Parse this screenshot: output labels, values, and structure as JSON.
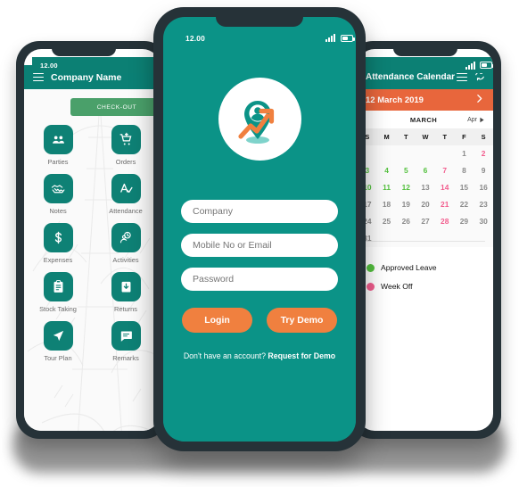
{
  "left_phone": {
    "status_time": "12.00",
    "appbar": {
      "menu_icon": "hamburger-icon",
      "title": "Company Name"
    },
    "checkout_label": "CHECK-OUT",
    "menu_items": [
      {
        "label": "Parties",
        "icon": "people-group-icon"
      },
      {
        "label": "Orders",
        "icon": "shopping-cart-plus-icon"
      },
      {
        "label": "Notes",
        "icon": "handshake-icon"
      },
      {
        "label": "Attendance",
        "icon": "attendance-check-icon"
      },
      {
        "label": "Expenses",
        "icon": "dollar-icon"
      },
      {
        "label": "Activities",
        "icon": "activity-chat-icon"
      },
      {
        "label": "Stock Taking",
        "icon": "clipboard-icon"
      },
      {
        "label": "Returns",
        "icon": "return-box-icon"
      },
      {
        "label": "Tour Plan",
        "icon": "navigation-arrow-icon"
      },
      {
        "label": "Remarks",
        "icon": "message-icon"
      }
    ]
  },
  "center_phone": {
    "status_time": "12.00",
    "logo_icon": "location-pin-growth-logo",
    "fields": [
      {
        "placeholder": "Company",
        "value": "",
        "name": "company-field"
      },
      {
        "placeholder": "Mobile No or Email",
        "value": "",
        "name": "mobile-email-field"
      },
      {
        "placeholder": "Password",
        "value": "",
        "name": "password-field"
      }
    ],
    "buttons": {
      "login": "Login",
      "try_demo": "Try Demo"
    },
    "signup": {
      "prefix": "Don't have an account? ",
      "link": "Request for Demo"
    }
  },
  "right_phone": {
    "appbar": {
      "title": "Attendance Calendar",
      "menu_icon": "hamburger-icon",
      "refresh_icon": "refresh-icon"
    },
    "date_bar": {
      "label": "12 March 2019",
      "next_icon": "chevron-right-icon"
    },
    "month_row": {
      "month": "MARCH",
      "next_month": "Apr",
      "next_icon": "play-right-icon"
    },
    "day_headers": [
      "S",
      "M",
      "T",
      "W",
      "T",
      "F",
      "S"
    ],
    "weeks": [
      [
        {
          "d": "",
          "t": "empty"
        },
        {
          "d": "",
          "t": "empty"
        },
        {
          "d": "",
          "t": "empty"
        },
        {
          "d": "",
          "t": "empty"
        },
        {
          "d": "",
          "t": "empty"
        },
        {
          "d": "1",
          "t": "grey"
        },
        {
          "d": "2",
          "t": "pink"
        }
      ],
      [
        {
          "d": "3",
          "t": "green"
        },
        {
          "d": "4",
          "t": "green"
        },
        {
          "d": "5",
          "t": "green"
        },
        {
          "d": "6",
          "t": "green"
        },
        {
          "d": "7",
          "t": "pink"
        },
        {
          "d": "8",
          "t": "grey"
        },
        {
          "d": "9",
          "t": "grey"
        }
      ],
      [
        {
          "d": "10",
          "t": "green"
        },
        {
          "d": "11",
          "t": "green"
        },
        {
          "d": "12",
          "t": "green"
        },
        {
          "d": "13",
          "t": "grey"
        },
        {
          "d": "14",
          "t": "pink"
        },
        {
          "d": "15",
          "t": "grey"
        },
        {
          "d": "16",
          "t": "grey"
        }
      ],
      [
        {
          "d": "17",
          "t": "grey"
        },
        {
          "d": "18",
          "t": "grey"
        },
        {
          "d": "19",
          "t": "grey"
        },
        {
          "d": "20",
          "t": "grey"
        },
        {
          "d": "21",
          "t": "pink"
        },
        {
          "d": "22",
          "t": "grey"
        },
        {
          "d": "23",
          "t": "grey"
        }
      ],
      [
        {
          "d": "24",
          "t": "grey"
        },
        {
          "d": "25",
          "t": "grey"
        },
        {
          "d": "26",
          "t": "grey"
        },
        {
          "d": "27",
          "t": "grey"
        },
        {
          "d": "28",
          "t": "pink"
        },
        {
          "d": "29",
          "t": "grey"
        },
        {
          "d": "30",
          "t": "grey"
        }
      ],
      [
        {
          "d": "31",
          "t": "grey"
        },
        {
          "d": "",
          "t": "empty"
        },
        {
          "d": "",
          "t": "empty"
        },
        {
          "d": "",
          "t": "empty"
        },
        {
          "d": "",
          "t": "empty"
        },
        {
          "d": "",
          "t": "empty"
        },
        {
          "d": "",
          "t": "empty"
        }
      ]
    ],
    "legend": [
      {
        "label": "Approved Leave",
        "color": "#54c13f"
      },
      {
        "label": "Week Off",
        "color": "#f25d8e"
      }
    ]
  },
  "colors": {
    "teal_primary": "#0b9387",
    "teal_dark": "#0b8075",
    "orange": "#f0803f",
    "orange_dark": "#e8663c",
    "green_light": "#4aa06a",
    "bezel": "#263238",
    "day_green": "#54c13f",
    "day_pink": "#f25d8e",
    "day_grey": "#8a8a8a"
  }
}
